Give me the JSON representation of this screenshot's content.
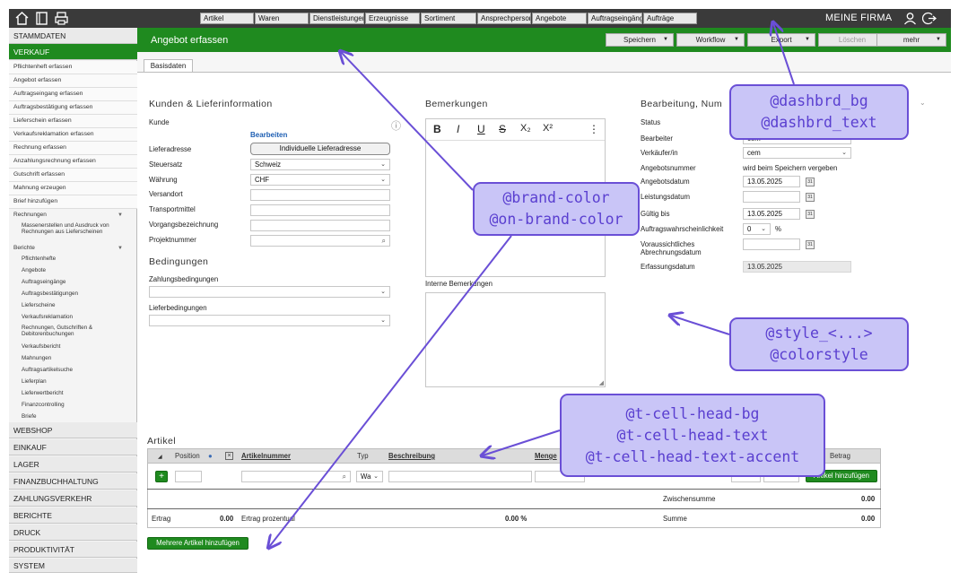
{
  "topbar": {
    "tabs": [
      "Artikel",
      "Waren",
      "Dienstleistungen",
      "Erzeugnisse",
      "Sortiment",
      "Ansprechpersonen",
      "Angebote",
      "Auftragseingänge",
      "Aufträge"
    ],
    "company": "MEINE FIRMA",
    "icons": [
      "home-icon",
      "window-icon",
      "printer-icon",
      "user-icon",
      "logout-icon"
    ]
  },
  "sidebar": {
    "main_top": [
      "STAMMDATEN",
      "VERKAUF"
    ],
    "items": [
      "Pflichtenheft erfassen",
      "Angebot erfassen",
      "Auftragseingang erfassen",
      "Auftragsbestätigung erfassen",
      "Lieferschein erfassen",
      "Verkaufsreklamation erfassen",
      "Rechnung erfassen",
      "Anzahlungsrechnung erfassen",
      "Gutschrift erfassen",
      "Mahnung erzeugen",
      "Brief hinzufügen"
    ],
    "group_rechnungen": "Rechnungen",
    "sub_rechnungen": [
      "Massenerstellen und Ausdruck von Rechnungen aus Lieferscheinen"
    ],
    "group_berichte": "Berichte",
    "sub_berichte": [
      "Pflichtenhefte",
      "Angebote",
      "Auftragseingänge",
      "Auftragsbestätigungen",
      "Lieferscheine",
      "Verkaufsreklamation",
      "Rechnungen, Gutschriften & Debitorenbuchungen",
      "Verkaufsbericht",
      "Mahnungen",
      "Auftragsartikelsuche",
      "Lieferplan",
      "Lieferwertbericht",
      "Finanzcontrolling",
      "Briefe"
    ],
    "main_bottom": [
      "WEBSHOP",
      "EINKAUF",
      "LAGER",
      "FINANZBUCHHALTUNG",
      "ZAHLUNGSVERKEHR",
      "BERICHTE",
      "DRUCK",
      "PRODUKTIVITÄT",
      "SYSTEM"
    ]
  },
  "header": {
    "title": "Angebot erfassen",
    "buttons": {
      "save": "Speichern",
      "workflow": "Workflow",
      "export": "Export",
      "delete": "Löschen",
      "more": "mehr"
    }
  },
  "tabs": {
    "basis": "Basisdaten"
  },
  "kunden": {
    "title": "Kunden & Lieferinformation",
    "kunde_label": "Kunde",
    "bearbeiten": "Bearbeiten",
    "lieferadresse_label": "Lieferadresse",
    "lieferadresse_btn": "Individuelle Lieferadresse",
    "steuersatz_label": "Steuersatz",
    "steuersatz_value": "Schweiz",
    "waehrung_label": "Währung",
    "waehrung_value": "CHF",
    "versandort_label": "Versandort",
    "transportmittel_label": "Transportmittel",
    "vorgang_label": "Vorgangsbezeichnung",
    "projekt_label": "Projektnummer"
  },
  "bedingungen": {
    "title": "Bedingungen",
    "zahlung_label": "Zahlungsbedingungen",
    "liefer_label": "Lieferbedingungen"
  },
  "bemerkungen": {
    "title": "Bemerkungen",
    "toolbar": [
      "B",
      "I",
      "U",
      "S",
      "X₂",
      "X²",
      "⋮"
    ],
    "intern_label": "Interne Bemerkungen"
  },
  "bearbeitung": {
    "title": "Bearbeitung, Num",
    "status_label": "Status",
    "bearbeiter_label": "Bearbeiter",
    "bearbeiter_value": "cem",
    "verkaeufer_label": "Verkäufer/in",
    "verkaeufer_value": "cem",
    "angebotsnr_label": "Angebotsnummer",
    "angebotsnr_value": "wird beim Speichern vergeben",
    "angebotsdatum_label": "Angebotsdatum",
    "angebotsdatum_value": "13.05.2025",
    "leistungsdatum_label": "Leistungsdatum",
    "gueltig_label": "Gültig bis",
    "gueltig_value": "13.05.2025",
    "wahrsch_label": "Auftragswahrscheinlichkeit",
    "wahrsch_value": "0",
    "percent": "%",
    "abrechnung_label": "Voraussichtliches Abrechnungsdatum",
    "erfassung_label": "Erfassungsdatum",
    "erfassung_value": "13.05.2025"
  },
  "artikel": {
    "title": "Artikel",
    "col_position": "Position",
    "col_artikelnummer": "Artikelnummer",
    "col_typ": "Typ",
    "col_beschreibung": "Beschreibung",
    "col_menge": "Menge",
    "col_betrag": "Betrag",
    "add_btn": "+",
    "typ_value": "Wa",
    "hinzufuegen_btn": "Artikel hinzufügen",
    "zwischensumme_label": "Zwischensumme",
    "zwischensumme_value": "0.00",
    "ertrag_label": "Ertrag",
    "ertrag_value": "0.00",
    "ertrag_prozentual_label": "Ertrag prozentual",
    "ertrag_prozentual_value": "0.00 %",
    "summe_label": "Summe",
    "summe_value": "0.00",
    "mehrere_btn": "Mehrere Artikel hinzufügen"
  },
  "annotations": {
    "dashbrd": [
      "@dashbrd_bg",
      "@dashbrd_text"
    ],
    "brand": [
      "@brand-color",
      "@on-brand-color"
    ],
    "style": [
      "@style_<...>",
      "@colorstyle"
    ],
    "cellhead": [
      "@t-cell-head-bg",
      "@t-cell-head-text",
      "@t-cell-head-text-accent"
    ]
  },
  "colors": {
    "brand": "#1f8a1f",
    "dashbrd_bg": "#3a3a3a",
    "annotation_bg": "#c9c5f7",
    "annotation_border": "#6a4fd6"
  }
}
